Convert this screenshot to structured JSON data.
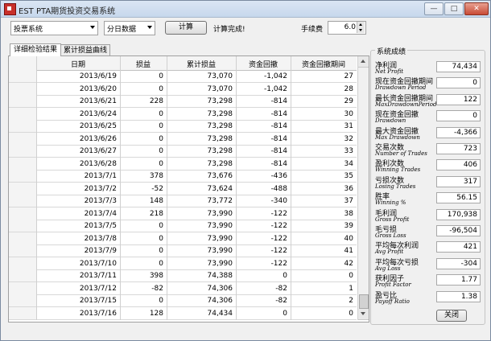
{
  "window": {
    "title": "EST PTA期货投资交易系统",
    "btn_min": "—",
    "btn_max": "□",
    "btn_close": "✕"
  },
  "toolbar": {
    "system_select": "投票系统",
    "data_select": "分日数据",
    "calc_button": "计算",
    "status": "计算完成!",
    "fee_label": "手续费",
    "fee_value": "6.0"
  },
  "tabs": [
    {
      "label": "详细检验结果"
    },
    {
      "label": "累计损益曲线"
    }
  ],
  "table": {
    "headers": [
      "日期",
      "损益",
      "累计损益",
      "资金回撤",
      "资金回撤期间"
    ],
    "rows": [
      [
        "2013/6/19",
        "0",
        "73,070",
        "-1,042",
        "27"
      ],
      [
        "2013/6/20",
        "0",
        "73,070",
        "-1,042",
        "28"
      ],
      [
        "2013/6/21",
        "228",
        "73,298",
        "-814",
        "29"
      ],
      [
        "2013/6/24",
        "0",
        "73,298",
        "-814",
        "30"
      ],
      [
        "2013/6/25",
        "0",
        "73,298",
        "-814",
        "31"
      ],
      [
        "2013/6/26",
        "0",
        "73,298",
        "-814",
        "32"
      ],
      [
        "2013/6/27",
        "0",
        "73,298",
        "-814",
        "33"
      ],
      [
        "2013/6/28",
        "0",
        "73,298",
        "-814",
        "34"
      ],
      [
        "2013/7/1",
        "378",
        "73,676",
        "-436",
        "35"
      ],
      [
        "2013/7/2",
        "-52",
        "73,624",
        "-488",
        "36"
      ],
      [
        "2013/7/3",
        "148",
        "73,772",
        "-340",
        "37"
      ],
      [
        "2013/7/4",
        "218",
        "73,990",
        "-122",
        "38"
      ],
      [
        "2013/7/5",
        "0",
        "73,990",
        "-122",
        "39"
      ],
      [
        "2013/7/8",
        "0",
        "73,990",
        "-122",
        "40"
      ],
      [
        "2013/7/9",
        "0",
        "73,990",
        "-122",
        "41"
      ],
      [
        "2013/7/10",
        "0",
        "73,990",
        "-122",
        "42"
      ],
      [
        "2013/7/11",
        "398",
        "74,388",
        "0",
        "0"
      ],
      [
        "2013/7/12",
        "-82",
        "74,306",
        "-82",
        "1"
      ],
      [
        "2013/7/15",
        "0",
        "74,306",
        "-82",
        "2"
      ],
      [
        "2013/7/16",
        "128",
        "74,434",
        "0",
        "0"
      ]
    ]
  },
  "stats": {
    "title": "系统成绩",
    "items": [
      {
        "zh": "净利润",
        "en": "Net Profit",
        "value": "74,434"
      },
      {
        "zh": "现在资金回撤期间",
        "en": "Drawdown Period",
        "value": "0"
      },
      {
        "zh": "最长资金回撤期间",
        "en": "MaxDrawdownPeriod",
        "value": "122"
      },
      {
        "zh": "现在资金回撤",
        "en": "Drawdown",
        "value": "0"
      },
      {
        "zh": "最大资金回撤",
        "en": "Max Drawdown",
        "value": "-4,366"
      },
      {
        "zh": "交易次数",
        "en": "Number of Trades",
        "value": "723"
      },
      {
        "zh": "盈利次数",
        "en": "Winning Trades",
        "value": "406"
      },
      {
        "zh": "亏损次数",
        "en": "Losing Trades",
        "value": "317"
      },
      {
        "zh": "胜率",
        "en": "Winning %",
        "value": "56.15"
      },
      {
        "zh": "毛利润",
        "en": "Gross Profit",
        "value": "170,938"
      },
      {
        "zh": "毛亏损",
        "en": "Gross Loss",
        "value": "-96,504"
      },
      {
        "zh": "平均每次利润",
        "en": "Avg Profit",
        "value": "421"
      },
      {
        "zh": "平均每次亏损",
        "en": "Avg Loss",
        "value": "-304"
      },
      {
        "zh": "获利因子",
        "en": "Profit Factor",
        "value": "1.77"
      },
      {
        "zh": "盈亏比",
        "en": "Payoff Ratio",
        "value": "1.38"
      }
    ],
    "close_button": "关闭"
  }
}
